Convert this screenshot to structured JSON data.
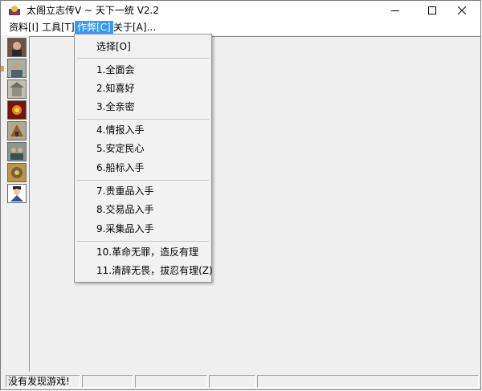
{
  "window": {
    "title": "太阁立志传V ~ 天下一统 V2.2",
    "minimize_icon": "minimize-icon",
    "maximize_icon": "maximize-icon",
    "close_icon": "close-icon"
  },
  "menubar": {
    "items": [
      {
        "label": "资料[I]"
      },
      {
        "label": "工具[T]"
      },
      {
        "label": "作弊[C]",
        "active": true
      },
      {
        "label": "关于[A]..."
      }
    ]
  },
  "sidebar": {
    "portraits": [
      "portrait-1",
      "portrait-2",
      "portrait-3",
      "portrait-4",
      "portrait-5",
      "portrait-6",
      "portrait-7",
      "portrait-8"
    ]
  },
  "dropdown": {
    "items": [
      "选择[O]",
      "1.全面会",
      "2.知喜好",
      "3.全亲密",
      "4.情报入手",
      "5.安定民心",
      "6.船标入手",
      "7.贵重品入手",
      "8.交易品入手",
      "9.采集品入手",
      "10.革命无罪，造反有理",
      "11.清辞无畏，拔忍有理(Z)"
    ]
  },
  "statusbar": {
    "message": "没有发现游戏!"
  },
  "colors": {
    "menu_highlight": "#3399ff",
    "window_bg": "#f0f0f0"
  }
}
